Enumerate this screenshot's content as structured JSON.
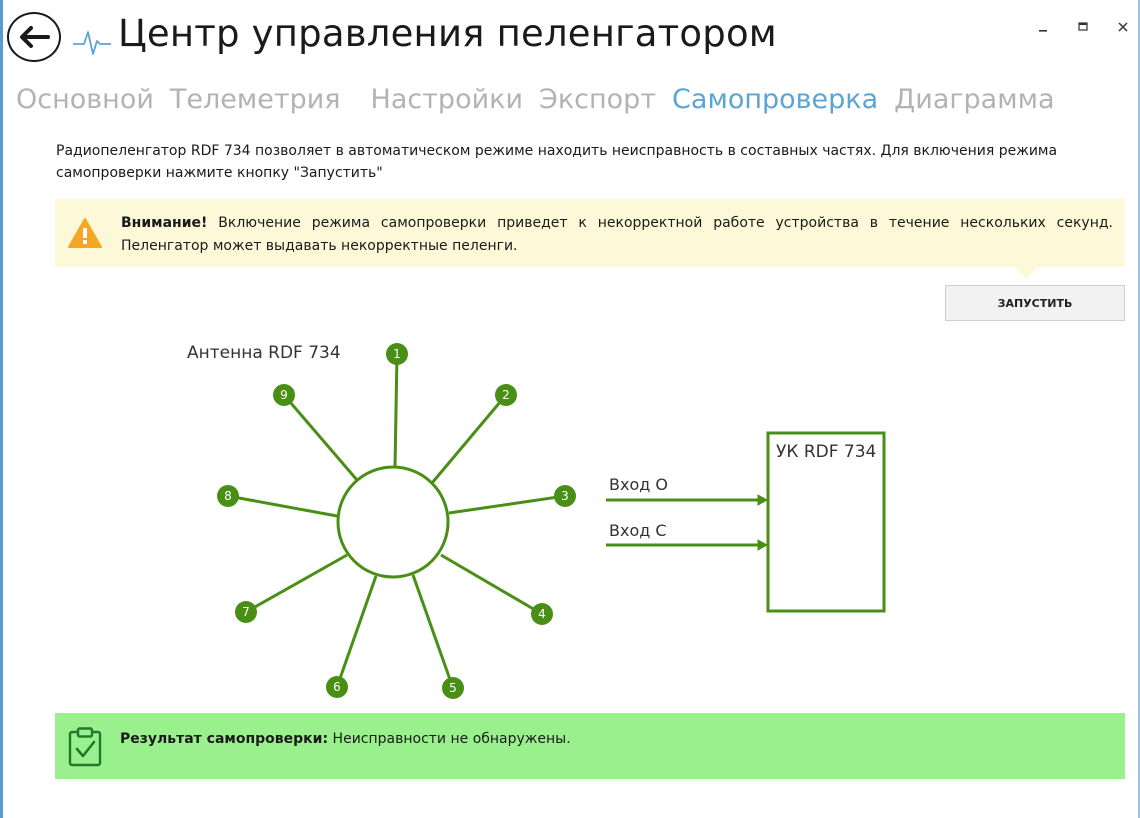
{
  "window": {
    "title": "Центр управления пеленгатором",
    "back_icon": "arrow-left-icon",
    "app_icon": "pulse-icon",
    "controls": [
      "minimize-icon",
      "maximize-icon",
      "close-icon"
    ]
  },
  "tabs": [
    {
      "label": "Основной",
      "active": false
    },
    {
      "label": "Телеметрия",
      "active": false
    },
    {
      "label": "Настройки",
      "active": false
    },
    {
      "label": "Экспорт",
      "active": false
    },
    {
      "label": "Самопроверка",
      "active": true
    },
    {
      "label": "Диаграмма",
      "active": false
    }
  ],
  "intro": {
    "text": "Радиопеленгатор RDF 734 позволяет в автоматическом режиме находить неисправность в составных частях. Для включения режима самопроверки нажмите кнопку \"Запустить\""
  },
  "warning": {
    "icon": "warning-triangle-icon",
    "title": "Внимание!",
    "text": "Включение режима самопроверки приведет к некорректной работе устройства в течение нескольких секунд. Пеленгатор может выдавать некорректные пеленги."
  },
  "start_button": {
    "label": "ЗАПУСТИТЬ"
  },
  "diagram": {
    "antenna_label": "Антенна RDF 734",
    "elements": [
      "1",
      "2",
      "3",
      "4",
      "5",
      "6",
      "7",
      "8",
      "9"
    ],
    "inputs": [
      "Вход О",
      "Вход С"
    ],
    "unit_label": "УК RDF 734"
  },
  "result": {
    "icon": "clipboard-check-icon",
    "title": "Результат самопроверки:",
    "text": "Неисправности не обнаружены."
  },
  "colors": {
    "accent": "#5aa5d6",
    "diagram_green": "#4a8f15",
    "warning_bg": "#fdf9d8",
    "result_bg": "#99f08c",
    "tab_inactive": "#b3b3b3"
  }
}
